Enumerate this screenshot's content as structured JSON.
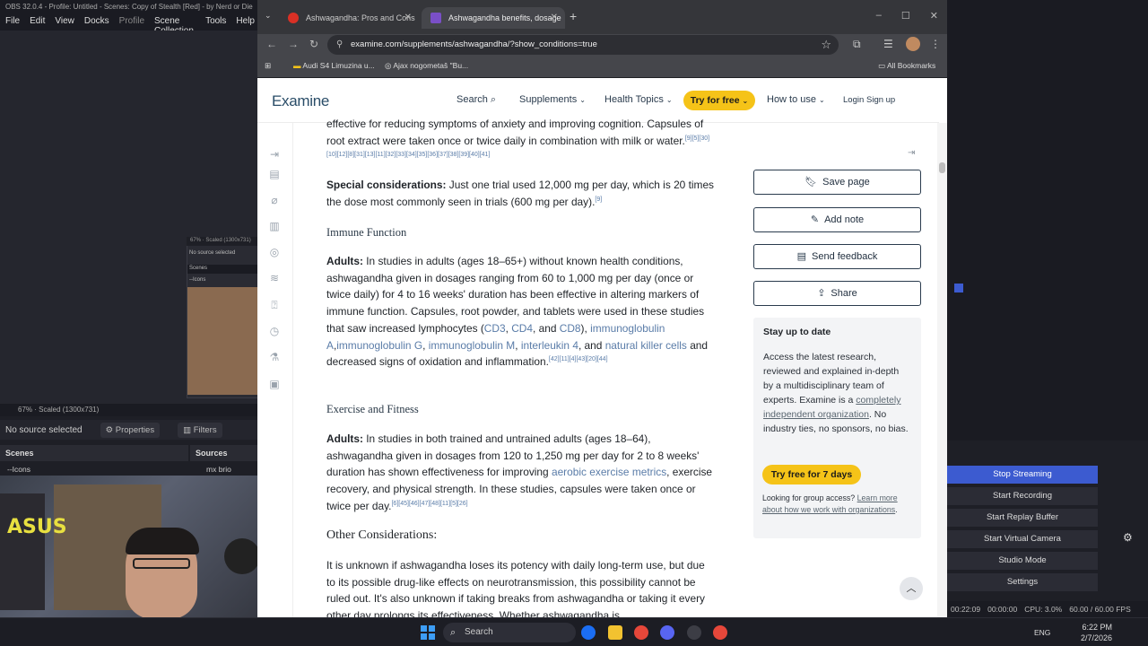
{
  "obs": {
    "title": "OBS 32.0.4 - Profile: Untitled - Scenes: Copy of Stealth [Red] - by Nerd or Die",
    "menu": [
      "File",
      "Edit",
      "View",
      "Docks",
      "Profile",
      "Scene Collection",
      "Tools",
      "Help"
    ],
    "mini_scale": "67%  ·  Scaled (1300x731)",
    "mini_label": "No source selected",
    "mini_scenes": "Scenes",
    "mini_icons": "--Icons",
    "preview_status": "67%   ·   Scaled (1300x731)",
    "no_source": "No source selected",
    "properties_label": "Properties",
    "filters_label": "Filters",
    "scenes_header": "Scenes",
    "scenes_item": "--Icons",
    "sources_header": "Sources",
    "sources_item": "mx brio",
    "webcam_sign": "ASUS",
    "controls": [
      "Stop Streaming",
      "Start Recording",
      "Start Replay Buffer",
      "Start Virtual Camera",
      "Studio Mode",
      "Settings"
    ],
    "status": {
      "stream_time": "00:22:09",
      "rec_time": "00:00:00",
      "cpu": "CPU: 3.0%",
      "fps": "60.00 / 60.00 FPS"
    }
  },
  "taskbar": {
    "search_placeholder": "Search",
    "lang": "ENG",
    "time": "6:22 PM",
    "date": "2/7/2026"
  },
  "browser": {
    "tabs": [
      {
        "title": "Ashwagandha: Pros and Cons",
        "active": false
      },
      {
        "title": "Ashwagandha benefits, dosage",
        "active": true
      }
    ],
    "url": "examine.com/supplements/ashwagandha/?show_conditions=true",
    "bookmarks": [
      "Audi S4 Limuzina u...",
      "Ajax nogometaš \"Bu...",
      "All Bookmarks"
    ]
  },
  "site": {
    "logo": "Examine",
    "nav": {
      "search": "Search",
      "supplements": "Supplements",
      "health_topics": "Health Topics",
      "try_free": "Try for free",
      "how_to_use": "How to use",
      "login": "Login",
      "signup": "Sign up"
    }
  },
  "article": {
    "p0_text": "effective for reducing symptoms of anxiety and improving cognition. Capsules of root extract were taken once or twice daily in combination with milk or water.",
    "p0_cites": "[9][5][30][10][12][8][31][13][11][32][33][34][35][36][37][38][39][40][41]",
    "special_label": "Special considerations:",
    "special_text": " Just one trial used 12,000 mg per day, which is 20 times the dose most commonly seen in trials (600 mg per day).",
    "special_cite": "[9]",
    "immune_heading": "Immune Function",
    "immune_label": "Adults:",
    "immune_text": " In studies in adults (ages 18–65+) without known health conditions, ashwagandha given in dosages ranging from 60 to 1,000 mg per day (once or twice daily) for 4 to 16 weeks' duration has been effective in altering markers of immune function. Capsules, root powder, and tablets were used in these studies that saw increased lymphocytes (",
    "immune_links": [
      "CD3",
      "CD4",
      "CD8",
      "immunoglobulin A",
      "immunoglobulin G",
      "immunoglobulin M",
      "interleukin 4",
      "natural killer cells"
    ],
    "immune_and": ", and ",
    "immune_tail": " and decreased signs of oxidation and inflammation.",
    "immune_cites": "[42][11][4][43][20][44]",
    "exercise_heading": "Exercise and Fitness",
    "exercise_label": "Adults:",
    "exercise_text": " In studies in both trained and untrained adults (ages 18–64), ashwagandha given in dosages from 120 to 1,250 mg per day for 2 to 8 weeks' duration has shown effectiveness for improving ",
    "exercise_link": "aerobic exercise metrics",
    "exercise_tail": ", exercise recovery, and physical strength. In these studies, capsules were taken once or twice per day.",
    "exercise_cites": "[6][45][46][47][48][11][5][26]",
    "other_heading": "Other Considerations:",
    "other_text": "It is unknown if ashwagandha loses its potency with daily long-term use, but due to its possible drug-like effects on neurotransmission, this possibility cannot be ruled out. It's also unknown if taking breaks from ashwagandha or taking it every other day prolongs its effectiveness. Whether ashwagandha is"
  },
  "sidebar": {
    "save_page": "Save page",
    "add_note": "Add note",
    "send_feedback": "Send feedback",
    "share": "Share",
    "stay_title": "Stay up to date",
    "stay_body_1": "Access the latest research, reviewed and explained in-depth by a multidisciplinary team of experts. Examine is a ",
    "stay_link": "completely independent organization",
    "stay_body_2": ". No industry ties, no sponsors, no bias.",
    "stay_cta": "Try free for 7 days",
    "group_1": "Looking for group access? ",
    "group_link": "Learn more about how we work with organizations",
    "group_2": "."
  }
}
